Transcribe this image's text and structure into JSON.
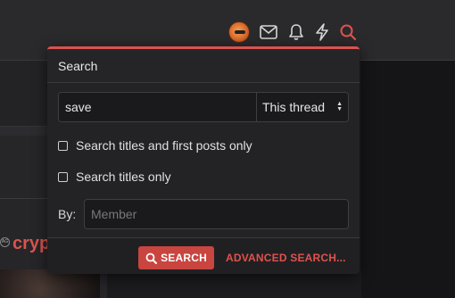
{
  "header_icons": {
    "avatar": "user-avatar",
    "mail": "envelope-icon",
    "bell": "bell-icon",
    "bolt": "lightning-icon",
    "search": "search-icon"
  },
  "colors": {
    "accent": "#d9534f",
    "button_bg": "#c9453f"
  },
  "background": {
    "logo_text": "cryp",
    "logo_mark": "AG"
  },
  "search_menu": {
    "title": "Search",
    "query_value": "save",
    "scope_selected": "This thread",
    "options": [
      {
        "label": "Search titles and first posts only",
        "checked": false
      },
      {
        "label": "Search titles only",
        "checked": false
      }
    ],
    "by_label": "By:",
    "member_placeholder": "Member",
    "search_button": "SEARCH",
    "advanced_link": "ADVANCED SEARCH..."
  }
}
